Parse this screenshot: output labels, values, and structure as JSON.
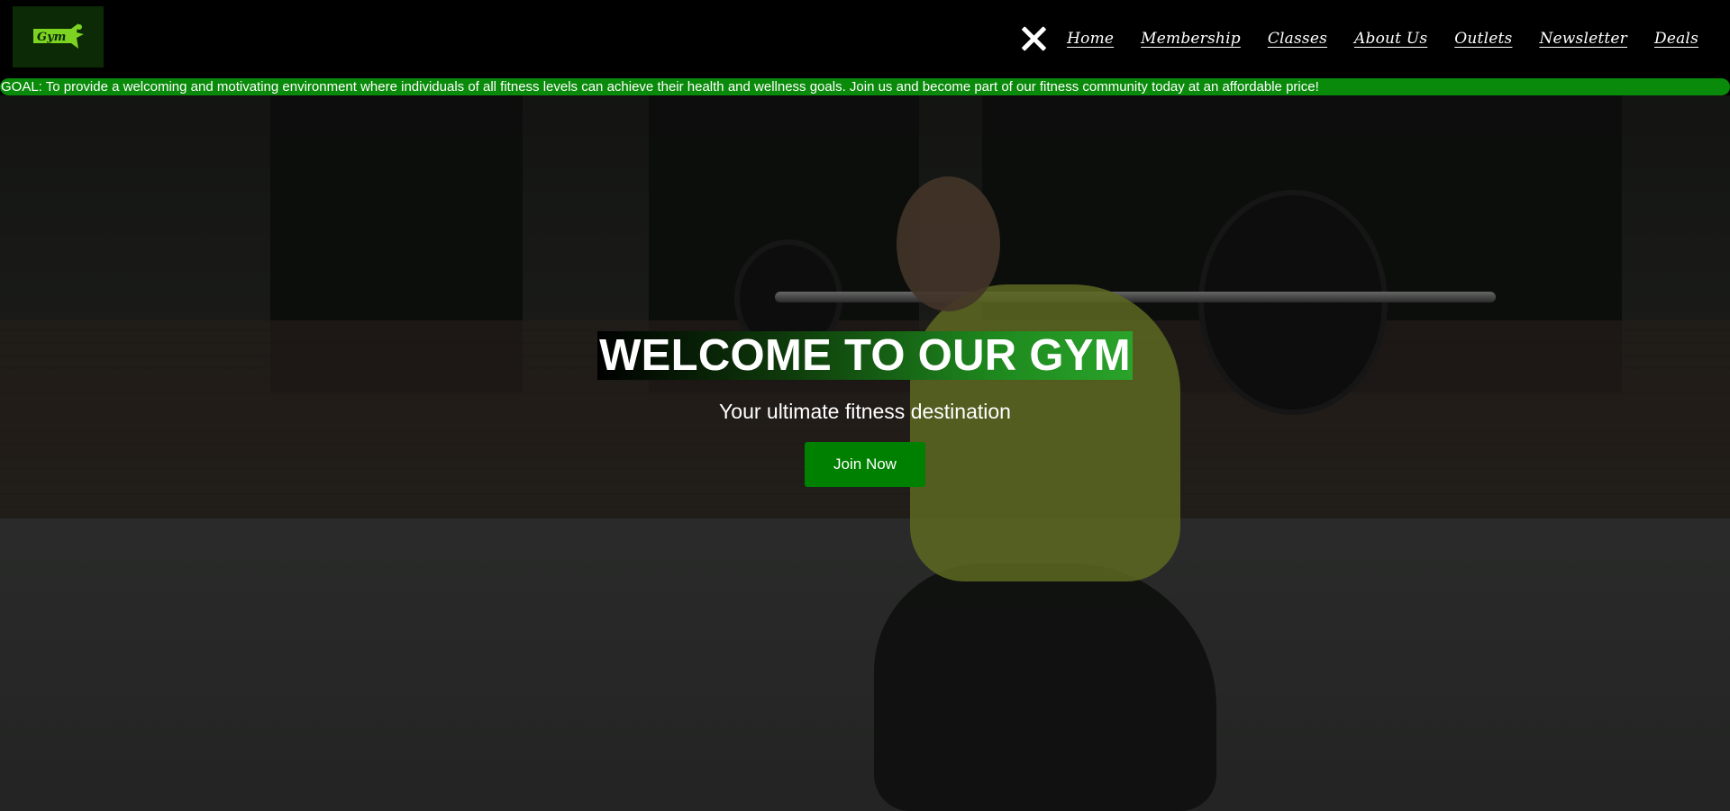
{
  "header": {
    "logo_text": "Gym",
    "nav": {
      "close_icon": "close-icon",
      "items": [
        {
          "label": "Home"
        },
        {
          "label": "Membership"
        },
        {
          "label": "Classes"
        },
        {
          "label": "About Us"
        },
        {
          "label": "Outlets"
        },
        {
          "label": "Newsletter"
        },
        {
          "label": "Deals"
        }
      ]
    }
  },
  "ticker": {
    "text": "GOAL: To provide a welcoming and motivating environment where individuals of all fitness levels can achieve their health and wellness goals. Join us and become part of our fitness community today at an affordable price!"
  },
  "hero": {
    "title": "WELCOME TO OUR GYM",
    "subtitle": "Your ultimate fitness destination",
    "cta_label": "Join Now"
  },
  "colors": {
    "accent_green": "#008000",
    "ticker_green": "#0a8a0a",
    "logo_green": "#7dd321",
    "background": "#000000"
  }
}
